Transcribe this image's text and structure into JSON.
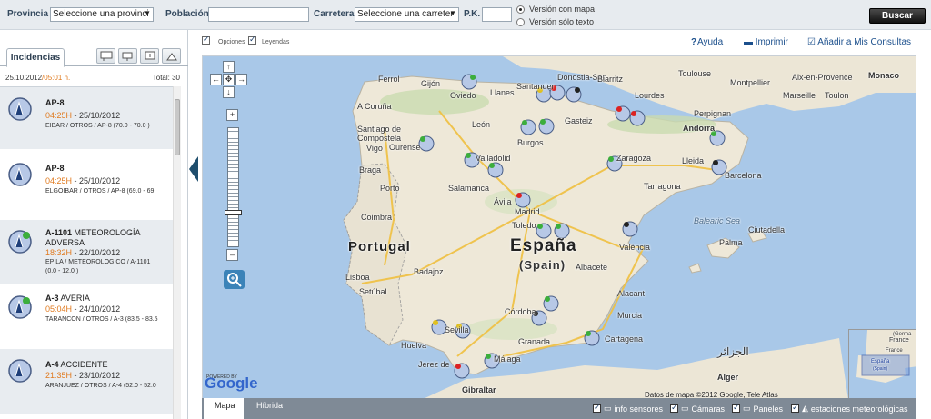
{
  "search": {
    "provincia_label": "Provincia",
    "provincia_value": "Seleccione una provinci",
    "poblacion_label": "Población",
    "poblacion_value": "",
    "carretera_label": "Carretera",
    "carretera_value": "Seleccione una carreter",
    "pk_label": "P.K.",
    "pk_value": "",
    "version_mapa": "Versión con mapa",
    "version_texto": "Versión sólo texto",
    "buscar_label": "Buscar"
  },
  "panel": {
    "tab_label": "Incidencias",
    "date": "25.10.2012",
    "time": "/05:01 h.",
    "total": "Total: 30"
  },
  "incidents": [
    {
      "road": "AP-8",
      "type": "",
      "time": "04:25H",
      "date": " - 25/10/2012",
      "location": "EIBAR / OTROS / AP-8 (70.0 - 70.0 )"
    },
    {
      "road": "AP-8",
      "type": "",
      "time": "04:25H",
      "date": " - 25/10/2012",
      "location": "ELGOIBAR / OTROS / AP-8 (69.0 - 69."
    },
    {
      "road": "A-1101",
      "type": " METEOROLOGÍA ADVERSA",
      "time": "18:32H",
      "date": " - 22/10/2012",
      "location": "EPILA / METEOROLÓGICO / A-1101",
      "location2": "(0.0 - 12.0 )"
    },
    {
      "road": "A-3",
      "type": " AVERÍA",
      "time": "05:04H",
      "date": " - 24/10/2012",
      "location": "TARANCON / OTROS / A-3 (83.5 - 83.5"
    },
    {
      "road": "A-4",
      "type": " ACCIDENTE",
      "time": "21:35H",
      "date": " - 23/10/2012",
      "location": "ARANJUEZ / OTROS / A-4 (52.0 - 52.0"
    }
  ],
  "maptools": {
    "opciones": "Opciones",
    "leyendas": "Leyendas",
    "ayuda": "Ayuda",
    "imprimir": "Imprimir",
    "anadir": "Añadir a Mis Consultas"
  },
  "map": {
    "country_main": "España",
    "country_sub": "(Spain)",
    "portugal": "Portugal",
    "cities": [
      "Ferrol",
      "Gijón",
      "Oviedo",
      "Llanes",
      "Santander",
      "Donostia-San",
      "Biarritz",
      "Lourdes",
      "Toulouse",
      "Montpellier",
      "Aix-en-Provence",
      "Marseille",
      "Toulon",
      "Monaco",
      "A Coruña",
      "Santiago de Compostela",
      "León",
      "Burgos",
      "Gasteiz",
      "Perpignan",
      "Andorra",
      "Vigo",
      "Ourense",
      "Valladolid",
      "Zaragoza",
      "Lleida",
      "Barcelona",
      "Braga",
      "Porto",
      "Salamanca",
      "Tarragona",
      "Ávila",
      "Madrid",
      "Coimbra",
      "Toledo",
      "Balearic Sea",
      "Palma",
      "Ciutadella",
      "Lisboa",
      "Badajoz",
      "Albacete",
      "València",
      "Setúbal",
      "Córdoba",
      "Murcia",
      "Alacant",
      "Sevilla",
      "Granada",
      "Cartagena",
      "Huelva",
      "Málaga",
      "Jerez de",
      "Gibraltar",
      "Alger",
      "الجزائر"
    ],
    "copyright": "Datos de mapa ©2012 Google, Tele Atlas",
    "google": "Google",
    "powered_by": "POWERED BY",
    "overview": {
      "country": "España",
      "sub": "(Spain)",
      "germany": "(Germa",
      "france_fr": "France",
      "france": "France"
    }
  },
  "bottom": {
    "tab_mapa": "Mapa",
    "tab_hibrida": "Híbrida",
    "layers": [
      "info sensores",
      "Cámaras",
      "Paneles",
      "estaciones meteorológicas"
    ]
  },
  "colors": {
    "accent": "#1b4f8c",
    "time": "#e07a1f",
    "dark_button": "#111111",
    "bottom_bar": "#7f8a96"
  }
}
